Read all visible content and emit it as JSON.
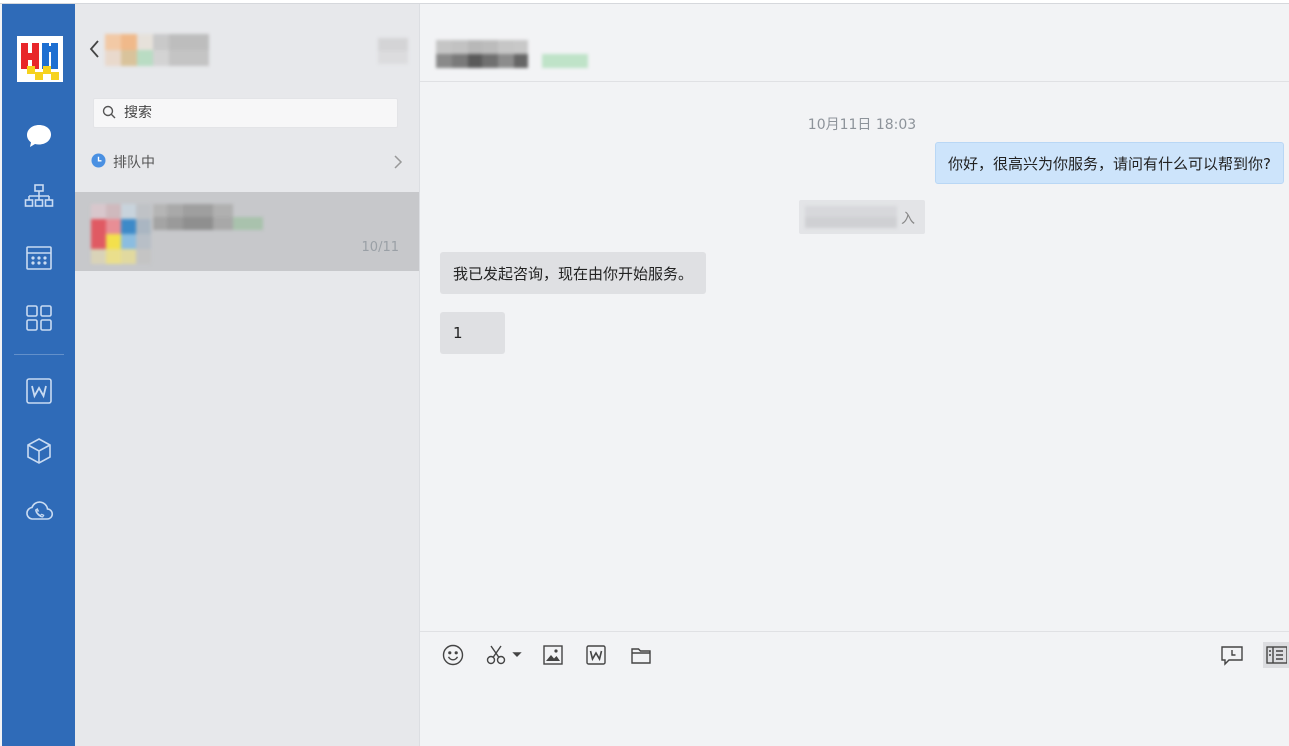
{
  "conversation_list": {
    "search": {
      "placeholder": "搜索"
    },
    "queue": {
      "label": "排队中"
    },
    "items": [
      {
        "time": "10/11"
      }
    ]
  },
  "chat": {
    "messages": [
      {
        "type": "timestamp",
        "text": "10月11日 18:03"
      },
      {
        "type": "outgoing",
        "text": "你好，很高兴为你服务，请问有什么可以帮到你?"
      },
      {
        "type": "system",
        "text": "入"
      },
      {
        "type": "incoming",
        "text": "我已发起咨询，现在由你开始服务。"
      },
      {
        "type": "incoming",
        "text": "1"
      }
    ]
  },
  "colors": {
    "rail": "#2f6bb8",
    "accent": "#4a90e2",
    "outgoing_bubble": "#cde4fb",
    "incoming_bubble": "#dfe0e3"
  }
}
